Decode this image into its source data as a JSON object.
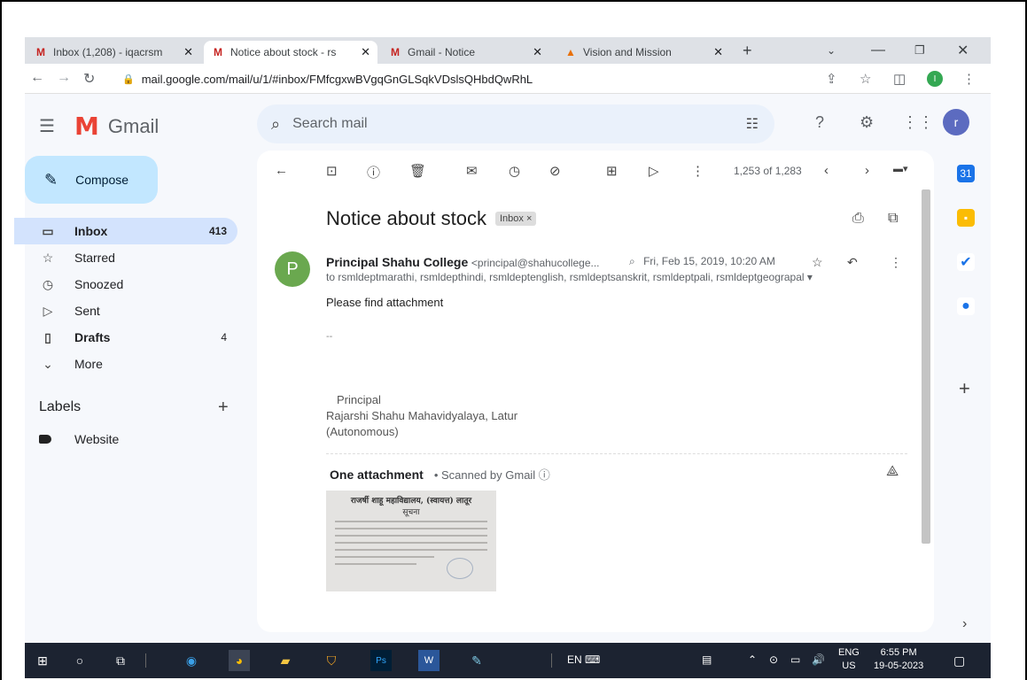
{
  "browser": {
    "tabs": [
      {
        "title": "Inbox (1,208) - iqacrsm",
        "icon": "gmail-icon",
        "active": false
      },
      {
        "title": "Notice about stock - rs",
        "icon": "gmail-icon",
        "active": true
      },
      {
        "title": "Gmail - Notice",
        "icon": "gmail-icon",
        "active": false
      },
      {
        "title": "Vision and Mission",
        "icon": "site-icon",
        "active": false
      }
    ],
    "new_tab": "+",
    "url": "mail.google.com/mail/u/1/#inbox/FMfcgxwBVgqGnGLSqkVDslsQHbdQwRhL",
    "profile_initial": "I"
  },
  "gmail": {
    "app_name": "Gmail",
    "search_placeholder": "Search mail",
    "account_initial": "r",
    "compose_label": "Compose",
    "nav": [
      {
        "label": "Inbox",
        "count": "413",
        "icon": "inbox-icon",
        "active": true,
        "bold": true
      },
      {
        "label": "Starred",
        "count": "",
        "icon": "star-icon",
        "active": false,
        "bold": false
      },
      {
        "label": "Snoozed",
        "count": "",
        "icon": "clock-icon",
        "active": false,
        "bold": false
      },
      {
        "label": "Sent",
        "count": "",
        "icon": "send-icon",
        "active": false,
        "bold": false
      },
      {
        "label": "Drafts",
        "count": "4",
        "icon": "file-icon",
        "active": false,
        "bold": true
      },
      {
        "label": "More",
        "count": "",
        "icon": "chevron-down-icon",
        "active": false,
        "bold": false
      }
    ],
    "labels_heading": "Labels",
    "labels": [
      {
        "name": "Website"
      }
    ],
    "pager": "1,253 of 1,283",
    "message": {
      "subject": "Notice about stock",
      "chip": "Inbox ×",
      "sender_initial": "P",
      "sender_name": "Principal Shahu College",
      "sender_email": "<principal@shahucollege...",
      "date": "Fri, Feb 15, 2019, 10:20 AM",
      "to": "to rsmldeptmarathi, rsmldepthindi, rsmldeptenglish, rsmldeptsanskrit, rsmldeptpali, rsmldeptgeograpal",
      "body": "Please find attachment",
      "sig_dash": "--",
      "signature": [
        "Principal",
        "Rajarshi Shahu Mahavidyalaya, Latur",
        "(Autonomous)"
      ],
      "attachment_heading": "One attachment",
      "scanned": "• Scanned by Gmail ⓘ",
      "thumb_title": "राजर्षी शाहू महाविद्यालय, (स्वायत्त) लातूर",
      "thumb_sub": "सूचना"
    }
  },
  "taskbar": {
    "input_lang": "EN",
    "lang_top": "ENG",
    "lang_bottom": "US",
    "time": "6:55 PM",
    "date": "19-05-2023"
  }
}
